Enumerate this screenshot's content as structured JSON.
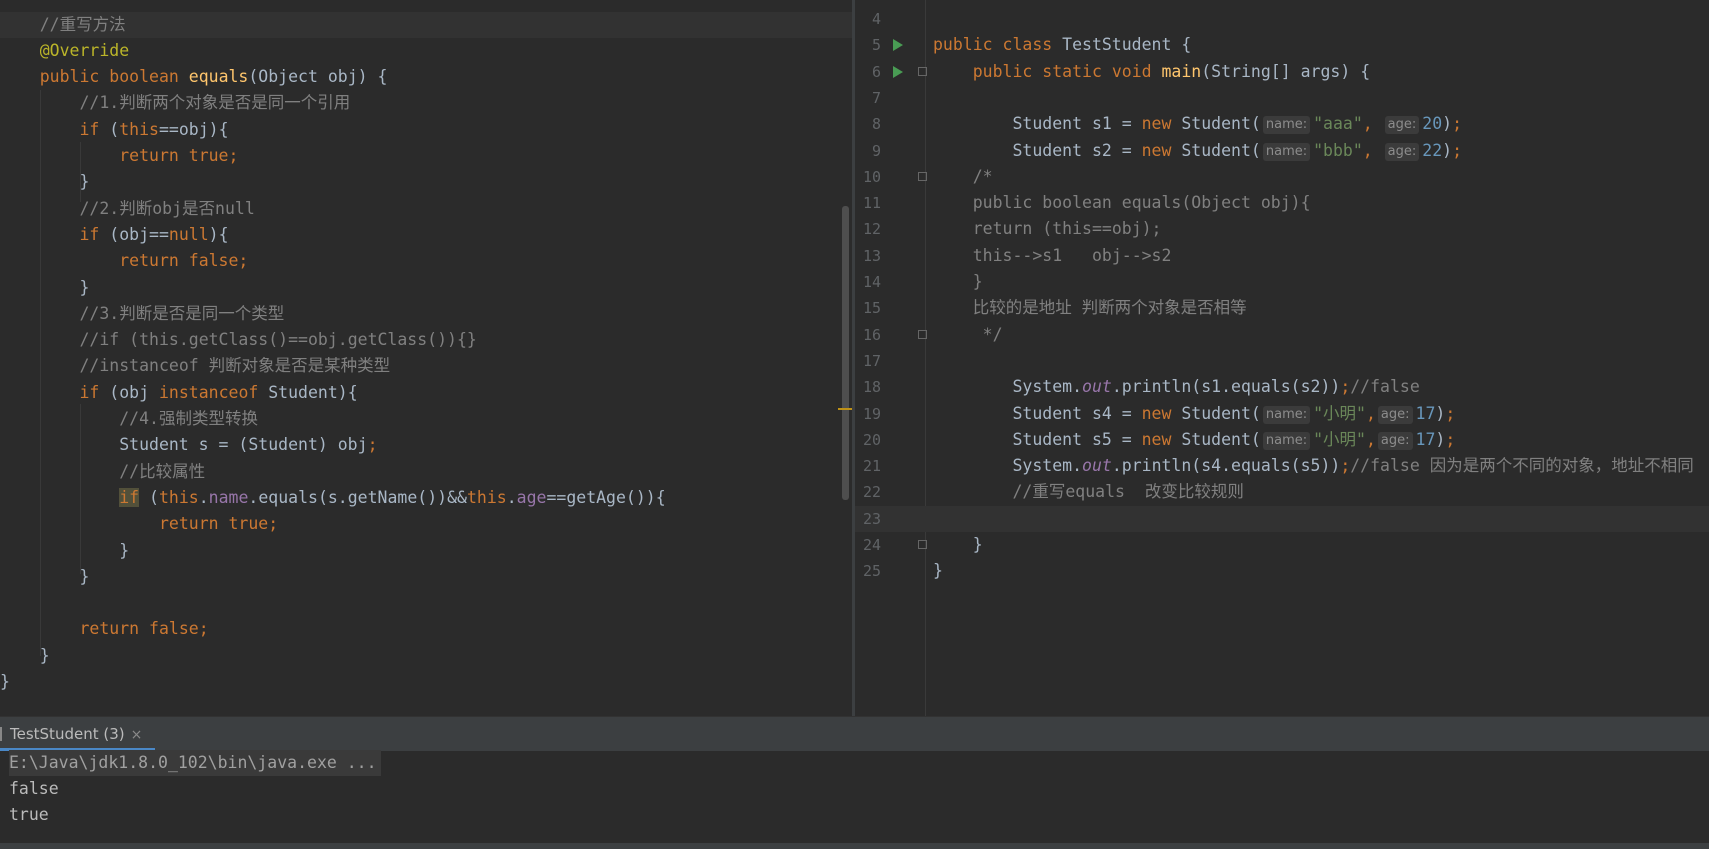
{
  "left_editor": {
    "lines": [
      [
        {
          "t": "    "
        },
        {
          "t": "//重写方法",
          "c": "cm"
        }
      ],
      [
        {
          "t": "    "
        },
        {
          "t": "@Override",
          "c": "an"
        }
      ],
      [
        {
          "t": "    "
        },
        {
          "t": "public boolean ",
          "c": "kw"
        },
        {
          "t": "equals",
          "c": "fn"
        },
        {
          "t": "(Object obj) {"
        }
      ],
      [
        {
          "t": "        "
        },
        {
          "t": "//1.判断两个对象是否是同一个引用",
          "c": "cm"
        }
      ],
      [
        {
          "t": "        "
        },
        {
          "t": "if ",
          "c": "kw"
        },
        {
          "t": "("
        },
        {
          "t": "this",
          "c": "kw"
        },
        {
          "t": "==obj){"
        }
      ],
      [
        {
          "t": "            "
        },
        {
          "t": "return true;",
          "c": "kw"
        }
      ],
      [
        {
          "t": "        }"
        }
      ],
      [
        {
          "t": "        "
        },
        {
          "t": "//2.判断obj是否null",
          "c": "cm"
        }
      ],
      [
        {
          "t": "        "
        },
        {
          "t": "if ",
          "c": "kw"
        },
        {
          "t": "(obj=="
        },
        {
          "t": "null",
          "c": "kw"
        },
        {
          "t": "){"
        }
      ],
      [
        {
          "t": "            "
        },
        {
          "t": "return false;",
          "c": "kw"
        }
      ],
      [
        {
          "t": "        }"
        }
      ],
      [
        {
          "t": "        "
        },
        {
          "t": "//3.判断是否是同一个类型",
          "c": "cm"
        }
      ],
      [
        {
          "t": "        "
        },
        {
          "t": "//if (this.getClass()==obj.getClass()){}",
          "c": "cm"
        }
      ],
      [
        {
          "t": "        "
        },
        {
          "t": "//instanceof 判断对象是否是某种类型",
          "c": "cm"
        }
      ],
      [
        {
          "t": "        "
        },
        {
          "t": "if ",
          "c": "kw"
        },
        {
          "t": "(obj "
        },
        {
          "t": "instanceof ",
          "c": "kw"
        },
        {
          "t": "Student){"
        }
      ],
      [
        {
          "t": "            "
        },
        {
          "t": "//4.强制类型转换",
          "c": "cm"
        }
      ],
      [
        {
          "t": "            Student s = (Student) obj"
        },
        {
          "t": ";",
          "c": "kw"
        }
      ],
      [
        {
          "t": "            "
        },
        {
          "t": "//比较属性",
          "c": "cm"
        }
      ],
      [
        {
          "t": "            "
        },
        {
          "t": "if",
          "c": "kw wr"
        },
        {
          "t": " ("
        },
        {
          "t": "this",
          "c": "kw"
        },
        {
          "t": "."
        },
        {
          "t": "name",
          "c": "fd"
        },
        {
          "t": ".equals(s.getName())&&"
        },
        {
          "t": "this",
          "c": "kw"
        },
        {
          "t": "."
        },
        {
          "t": "age",
          "c": "fd"
        },
        {
          "t": "==getAge()){"
        }
      ],
      [
        {
          "t": "                "
        },
        {
          "t": "return true;",
          "c": "kw"
        }
      ],
      [
        {
          "t": "            }"
        }
      ],
      [
        {
          "t": "        }"
        }
      ],
      [
        {
          "t": ""
        }
      ],
      [
        {
          "t": "        "
        },
        {
          "t": "return false;",
          "c": "kw"
        }
      ],
      [
        {
          "t": "    }"
        }
      ],
      [
        {
          "t": "}"
        }
      ]
    ]
  },
  "right_editor": {
    "lines": [
      {
        "n": "4",
        "seg": [
          {
            "t": ""
          }
        ]
      },
      {
        "n": "5",
        "seg": [
          {
            "t": "public class ",
            "c": "kw"
          },
          {
            "t": "TestStudent {"
          }
        ]
      },
      {
        "n": "6",
        "seg": [
          {
            "t": "    "
          },
          {
            "t": "public static void ",
            "c": "kw"
          },
          {
            "t": "main",
            "c": "fn"
          },
          {
            "t": "(String[] args) {"
          }
        ]
      },
      {
        "n": "7",
        "seg": [
          {
            "t": ""
          }
        ]
      },
      {
        "n": "8",
        "seg": [
          {
            "t": "        Student s1 = "
          },
          {
            "t": "new ",
            "c": "kw"
          },
          {
            "t": "Student("
          },
          {
            "t": "name:",
            "h": 1
          },
          {
            "t": "\"aaa\"",
            "c": "st"
          },
          {
            "t": ", ",
            "c": "kw"
          },
          {
            "t": "age:",
            "h": 1
          },
          {
            "t": "20",
            "c": "nm"
          },
          {
            "t": ")"
          },
          {
            "t": ";",
            "c": "kw"
          }
        ]
      },
      {
        "n": "9",
        "seg": [
          {
            "t": "        Student s2 = "
          },
          {
            "t": "new ",
            "c": "kw"
          },
          {
            "t": "Student("
          },
          {
            "t": "name:",
            "h": 1
          },
          {
            "t": "\"bbb\"",
            "c": "st"
          },
          {
            "t": ", ",
            "c": "kw"
          },
          {
            "t": "age:",
            "h": 1
          },
          {
            "t": "22",
            "c": "nm"
          },
          {
            "t": ")"
          },
          {
            "t": ";",
            "c": "kw"
          }
        ]
      },
      {
        "n": "10",
        "seg": [
          {
            "t": "    "
          },
          {
            "t": "/*",
            "c": "cm"
          }
        ]
      },
      {
        "n": "11",
        "seg": [
          {
            "t": "    "
          },
          {
            "t": "public boolean equals(Object obj){",
            "c": "cm"
          }
        ]
      },
      {
        "n": "12",
        "seg": [
          {
            "t": "    "
          },
          {
            "t": "return (this==obj);",
            "c": "cm"
          }
        ]
      },
      {
        "n": "13",
        "seg": [
          {
            "t": "    "
          },
          {
            "t": "this-->s1   obj-->s2",
            "c": "cm"
          }
        ]
      },
      {
        "n": "14",
        "seg": [
          {
            "t": "    "
          },
          {
            "t": "}",
            "c": "cm"
          }
        ]
      },
      {
        "n": "15",
        "seg": [
          {
            "t": "    "
          },
          {
            "t": "比较的是地址 判断两个对象是否相等",
            "c": "cm"
          }
        ]
      },
      {
        "n": "16",
        "seg": [
          {
            "t": "    "
          },
          {
            "t": " */",
            "c": "cm"
          }
        ]
      },
      {
        "n": "17",
        "seg": [
          {
            "t": ""
          }
        ]
      },
      {
        "n": "18",
        "seg": [
          {
            "t": "        System."
          },
          {
            "t": "out",
            "c": "sf"
          },
          {
            "t": ".println(s1.equals(s2))"
          },
          {
            "t": ";",
            "c": "kw"
          },
          {
            "t": "//false",
            "c": "cm"
          }
        ]
      },
      {
        "n": "19",
        "seg": [
          {
            "t": "        Student s4 = "
          },
          {
            "t": "new ",
            "c": "kw"
          },
          {
            "t": "Student("
          },
          {
            "t": "name:",
            "h": 1
          },
          {
            "t": "\"小明\"",
            "c": "st"
          },
          {
            "t": ",",
            "c": "kw"
          },
          {
            "t": "age:",
            "h": 1
          },
          {
            "t": "17",
            "c": "nm"
          },
          {
            "t": ")"
          },
          {
            "t": ";",
            "c": "kw"
          }
        ]
      },
      {
        "n": "20",
        "seg": [
          {
            "t": "        Student s5 = "
          },
          {
            "t": "new ",
            "c": "kw"
          },
          {
            "t": "Student("
          },
          {
            "t": "name:",
            "h": 1
          },
          {
            "t": "\"小明\"",
            "c": "st"
          },
          {
            "t": ",",
            "c": "kw"
          },
          {
            "t": "age:",
            "h": 1
          },
          {
            "t": "17",
            "c": "nm"
          },
          {
            "t": ")"
          },
          {
            "t": ";",
            "c": "kw"
          }
        ]
      },
      {
        "n": "21",
        "seg": [
          {
            "t": "        System."
          },
          {
            "t": "out",
            "c": "sf"
          },
          {
            "t": ".println(s4.equals(s5))"
          },
          {
            "t": ";",
            "c": "kw"
          },
          {
            "t": "//false 因为是两个不同的对象，地址不相同",
            "c": "cm"
          }
        ]
      },
      {
        "n": "22",
        "seg": [
          {
            "t": "        "
          },
          {
            "t": "//重写equals  改变比较规则",
            "c": "cm"
          }
        ]
      },
      {
        "n": "23",
        "seg": [
          {
            "t": ""
          }
        ]
      },
      {
        "n": "24",
        "seg": [
          {
            "t": "    }"
          }
        ]
      },
      {
        "n": "25",
        "seg": [
          {
            "t": "}"
          }
        ]
      }
    ]
  },
  "run_panel": {
    "tab_label": "TestStudent (3)",
    "close_glyph": "×",
    "command": "E:\\Java\\jdk1.8.0_102\\bin\\java.exe ...",
    "output": [
      "false",
      "true"
    ]
  },
  "colors": {
    "background": "#2b2b2b",
    "keyword": "#cc7832",
    "comment": "#808080",
    "string": "#6a8759",
    "number": "#6897bb",
    "method": "#ffc66d",
    "annotation": "#bbb529",
    "field": "#9876aa",
    "run_icon": "#499c54"
  }
}
